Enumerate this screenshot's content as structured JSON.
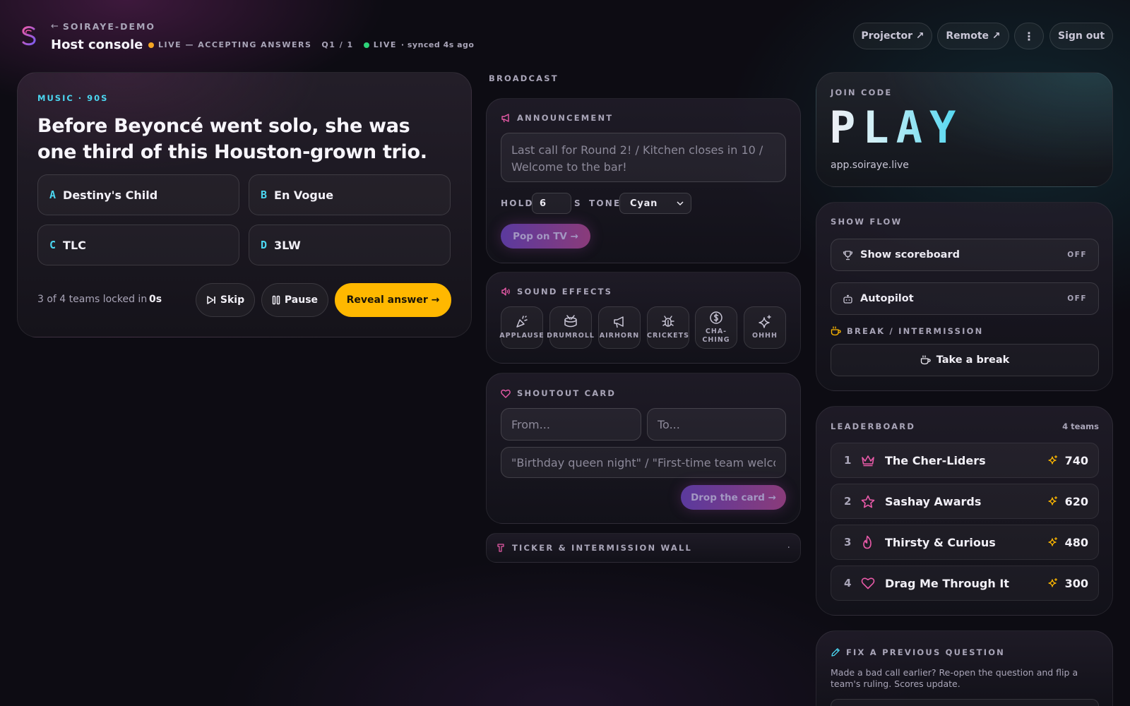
{
  "header": {
    "back_label": "SOIRAYE-DEMO",
    "title": "Host console",
    "status_text": "LIVE — ACCEPTING ANSWERS",
    "question_counter": "Q1 / 1",
    "live_label": "LIVE",
    "synced_text": "· synced 4s ago",
    "status_dot_color": "#F5A623",
    "live_dot_color": "#2ED47A",
    "buttons": {
      "projector": "Projector ↗",
      "remote": "Remote ↗",
      "more": "⋮",
      "sign_out": "Sign out"
    }
  },
  "question": {
    "category": "MUSIC · 90S",
    "text": "Before Beyoncé went solo, she was one third of this Houston-grown trio.",
    "answers": [
      {
        "letter": "A",
        "text": "Destiny's Child"
      },
      {
        "letter": "B",
        "text": "En Vogue"
      },
      {
        "letter": "C",
        "text": "TLC"
      },
      {
        "letter": "D",
        "text": "3LW"
      }
    ],
    "locked_in": "3 of 4 teams locked in",
    "timer": "0s",
    "skip_label": "Skip",
    "pause_label": "Pause",
    "reveal_label": "Reveal answer →"
  },
  "broadcast": {
    "heading": "BROADCAST",
    "announcement": {
      "title": "ANNOUNCEMENT",
      "placeholder": "Last call for Round 2! / Kitchen closes in 10 / Welcome to the bar!",
      "hold_label": "HOLD",
      "hold_value": "6",
      "hold_unit": "S",
      "tone_label": "TONE",
      "tone_value": "Cyan",
      "button": "Pop on TV →"
    },
    "sound_effects": {
      "title": "SOUND EFFECTS",
      "items": [
        {
          "label": "APPLAUSE",
          "icon": "party-popper-icon"
        },
        {
          "label": "DRUMROLL",
          "icon": "drum-icon"
        },
        {
          "label": "AIRHORN",
          "icon": "megaphone-icon"
        },
        {
          "label": "CRICKETS",
          "icon": "bug-icon"
        },
        {
          "label": "CHA-CHING",
          "icon": "dollar-coin-icon"
        },
        {
          "label": "OHHH",
          "icon": "sparkles-icon"
        }
      ]
    },
    "shoutout": {
      "title": "SHOUTOUT CARD",
      "from_placeholder": "From...",
      "to_placeholder": "To...",
      "message_placeholder": "\"Birthday queen night\" / \"First-time team welcome\"",
      "button": "Drop the card →"
    },
    "ticker": {
      "title": "TICKER & INTERMISSION WALL",
      "indicator": "·"
    }
  },
  "join": {
    "label": "JOIN CODE",
    "code": "PLAY",
    "url": "app.soiraye.live"
  },
  "show_flow": {
    "title": "SHOW FLOW",
    "scoreboard_label": "Show scoreboard",
    "scoreboard_state": "OFF",
    "autopilot_label": "Autopilot",
    "autopilot_state": "OFF",
    "break_title": "BREAK / INTERMISSION",
    "break_button": "Take a break"
  },
  "leaderboard": {
    "title": "LEADERBOARD",
    "count": "4 teams",
    "teams": [
      {
        "rank": "1",
        "name": "The Cher-Liders",
        "score": "740",
        "icon": "crown-icon"
      },
      {
        "rank": "2",
        "name": "Sashay Awards",
        "score": "620",
        "icon": "star-icon"
      },
      {
        "rank": "3",
        "name": "Thirsty & Curious",
        "score": "480",
        "icon": "flame-icon"
      },
      {
        "rank": "4",
        "name": "Drag Me Through It",
        "score": "300",
        "icon": "heart-icon"
      }
    ]
  },
  "fix_question": {
    "title": "FIX A PREVIOUS QUESTION",
    "description": "Made a bad call earlier? Re-open the question and flip a team's ruling. Scores update."
  },
  "colors": {
    "accent_cyan": "#4BD6F0",
    "accent_pink": "#E85AA8",
    "reveal_yellow": "#FFB800",
    "background": "#0D0C13"
  }
}
